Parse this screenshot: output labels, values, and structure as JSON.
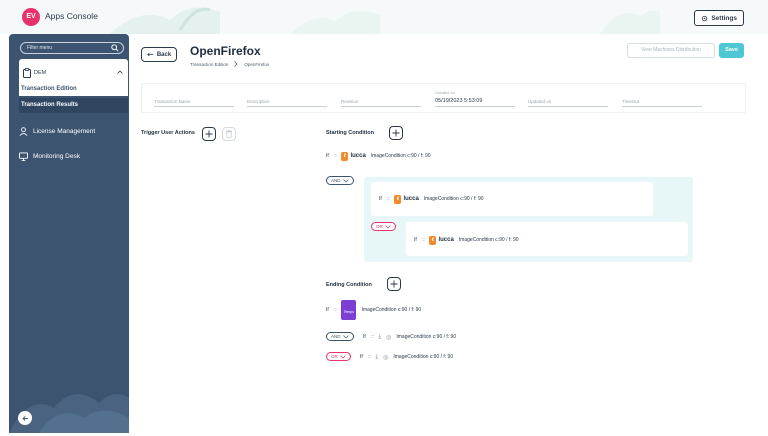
{
  "app": {
    "logo_text": "EV",
    "title": "Apps Console"
  },
  "header": {
    "settings_label": "Settings"
  },
  "sidebar": {
    "filter_placeholder": "Filter menu",
    "group_label": "DEM",
    "sub_items": [
      "Transaction Edition",
      "Transaction Results"
    ],
    "items": [
      "License Management",
      "Monitoring Desk"
    ]
  },
  "page": {
    "back_label": "Back",
    "title": "OpenFirefox",
    "breadcrumb": [
      "Transaction Edition",
      "OpenFirefox"
    ],
    "vmd_label": "View Machines Distribution",
    "save_label": "Save"
  },
  "fields": {
    "transaction_name": "Transaction Name",
    "description": "Description",
    "revision": "Revision",
    "created_on_label": "Created on",
    "created_on_value": "05/19/2023 5:53:09",
    "updated_on": "Updated on",
    "timeout": "TimeOut"
  },
  "trigger": {
    "label": "Trigger User Actions"
  },
  "starting": {
    "label": "Starting Condition",
    "if": "If",
    "drag": ":::",
    "brand": "lucca",
    "condition_text": "ImageCondition c:90 / f: 90",
    "and": "AND",
    "or": "OR",
    "nested_text": "ImageCondition c:90 / f: 90"
  },
  "ending": {
    "label": "Ending Condition",
    "if": "If",
    "drag": ":::",
    "tempo_label": "Tempo",
    "condition_text": "ImageCondition c:90 / f: 90",
    "and": "AND",
    "or": "OR"
  }
}
